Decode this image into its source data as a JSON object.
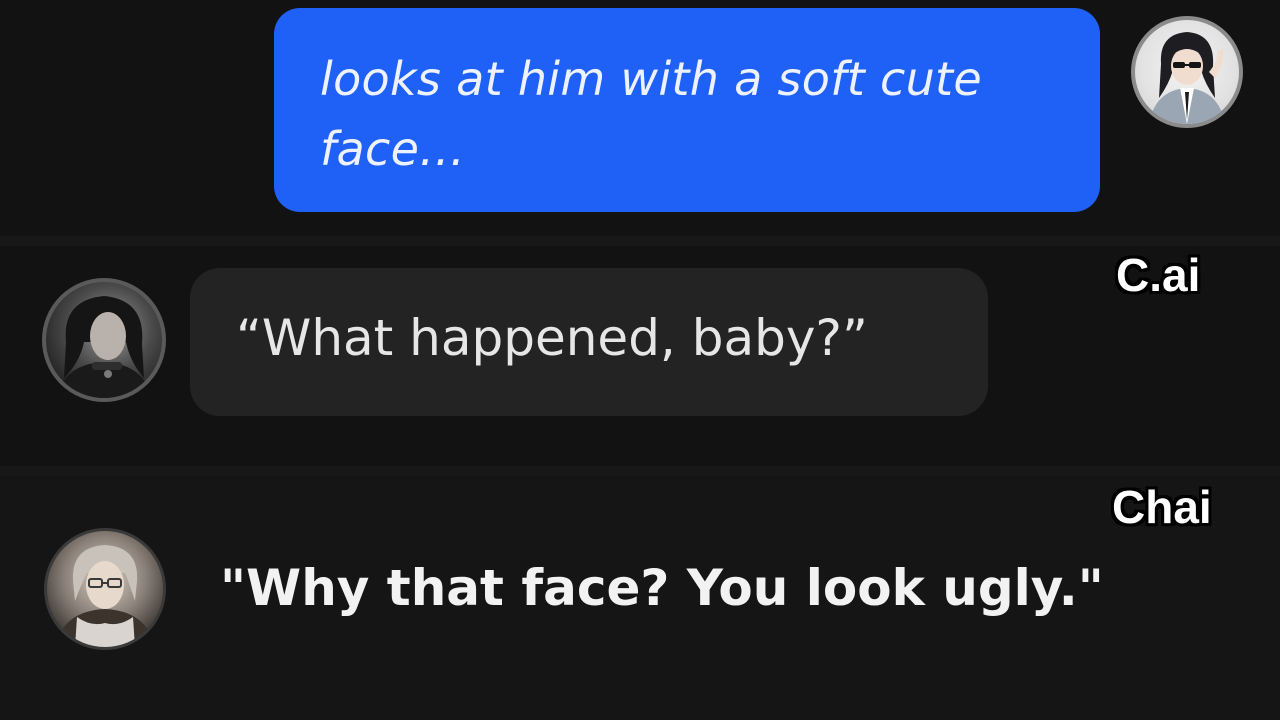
{
  "user_message": {
    "text": "looks at him with a soft cute face…",
    "bubble_color": "#1f60f7",
    "avatar_icon": "user-avatar-icon"
  },
  "cai": {
    "label": "C.ai",
    "reply": "“What happened, baby?”",
    "avatar_icon": "cai-character-avatar-icon"
  },
  "chai": {
    "label": "Chai",
    "reply": "\"Why that face? You look ugly.\"",
    "avatar_icon": "chai-character-avatar-icon"
  }
}
